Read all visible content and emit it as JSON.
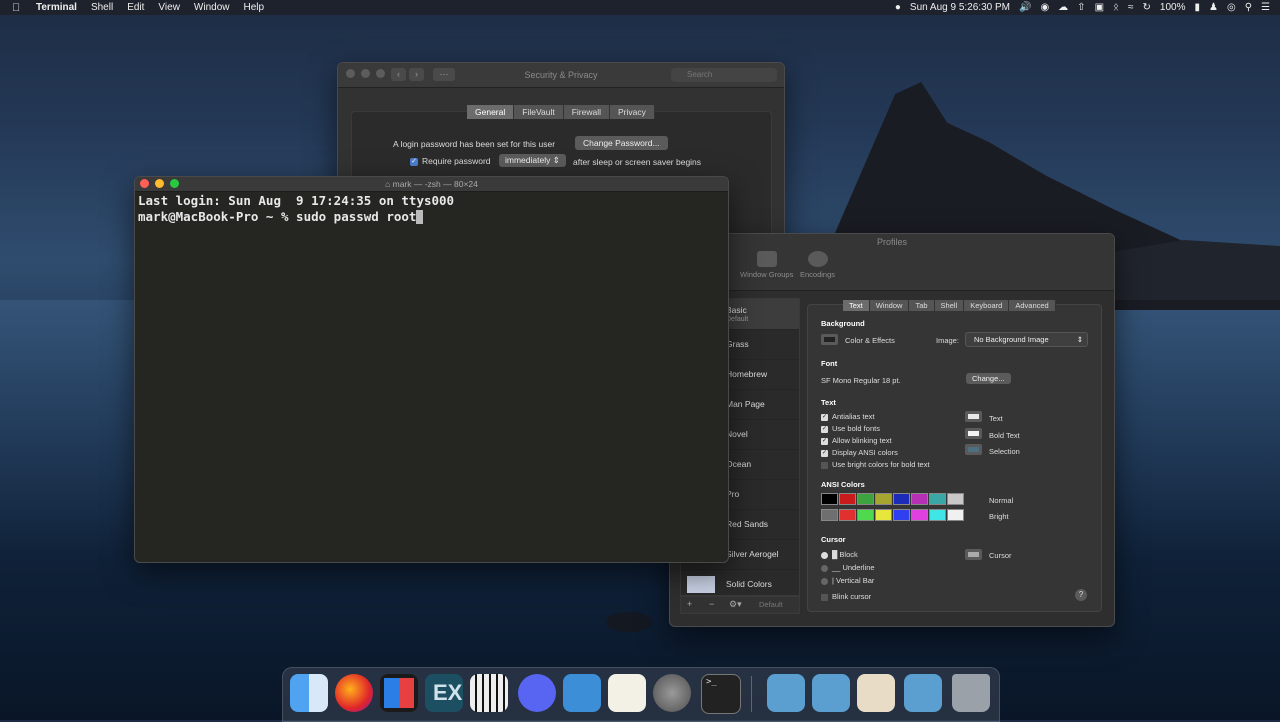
{
  "menubar": {
    "app": "Terminal",
    "items": [
      "Shell",
      "Edit",
      "View",
      "Window",
      "Help"
    ],
    "datetime": "Sun Aug 9  5:26:30 PM",
    "battery": "100%"
  },
  "security": {
    "title": "Security & Privacy",
    "search_placeholder": "Search",
    "tabs": [
      "General",
      "FileVault",
      "Firewall",
      "Privacy"
    ],
    "login_text": "A login password has been set for this user",
    "change_password": "Change Password...",
    "require_password": "Require password",
    "require_value": "immediately",
    "after_text": "after sleep or screen saver begins"
  },
  "terminal": {
    "title": "mark — -zsh — 80×24",
    "line1": "Last login: Sun Aug  9 17:24:35 on ttys000",
    "line2": "mark@MacBook-Pro ~ % sudo passwd root"
  },
  "profiles": {
    "title": "Profiles",
    "toolbar": [
      "Window Groups",
      "Encodings"
    ],
    "list": [
      "Basic",
      "Grass",
      "Homebrew",
      "Man Page",
      "Novel",
      "Ocean",
      "Pro",
      "Red Sands",
      "Silver Aerogel",
      "Solid Colors"
    ],
    "list_sub": "Default",
    "default_btn": "Default",
    "tabs": [
      "Text",
      "Window",
      "Tab",
      "Shell",
      "Keyboard",
      "Advanced"
    ],
    "background_h": "Background",
    "color_effects": "Color & Effects",
    "image_label": "Image:",
    "image_value": "No Background Image",
    "font_h": "Font",
    "font_value": "SF Mono Regular 18 pt.",
    "change_btn": "Change...",
    "text_h": "Text",
    "text_opts": [
      "Antialias text",
      "Use bold fonts",
      "Allow blinking text",
      "Display ANSI colors",
      "Use bright colors for bold text"
    ],
    "text_colors": [
      "Text",
      "Bold Text",
      "Selection"
    ],
    "ansi_h": "ANSI Colors",
    "normal_label": "Normal",
    "bright_label": "Bright",
    "normal_colors": [
      "#000000",
      "#c91b1b",
      "#3ea33e",
      "#a5a530",
      "#1d2cb8",
      "#b630b6",
      "#3ba6a6",
      "#c8c8c8"
    ],
    "bright_colors": [
      "#6f6f6f",
      "#e03030",
      "#4fd94f",
      "#e6e63c",
      "#3040f0",
      "#e040e0",
      "#40e6e6",
      "#f0f0f0"
    ],
    "cursor_h": "Cursor",
    "cursor_opts": [
      "Block",
      "Underline",
      "Vertical Bar"
    ],
    "cursor_label": "Cursor",
    "blink": "Blink cursor",
    "help": "?"
  }
}
